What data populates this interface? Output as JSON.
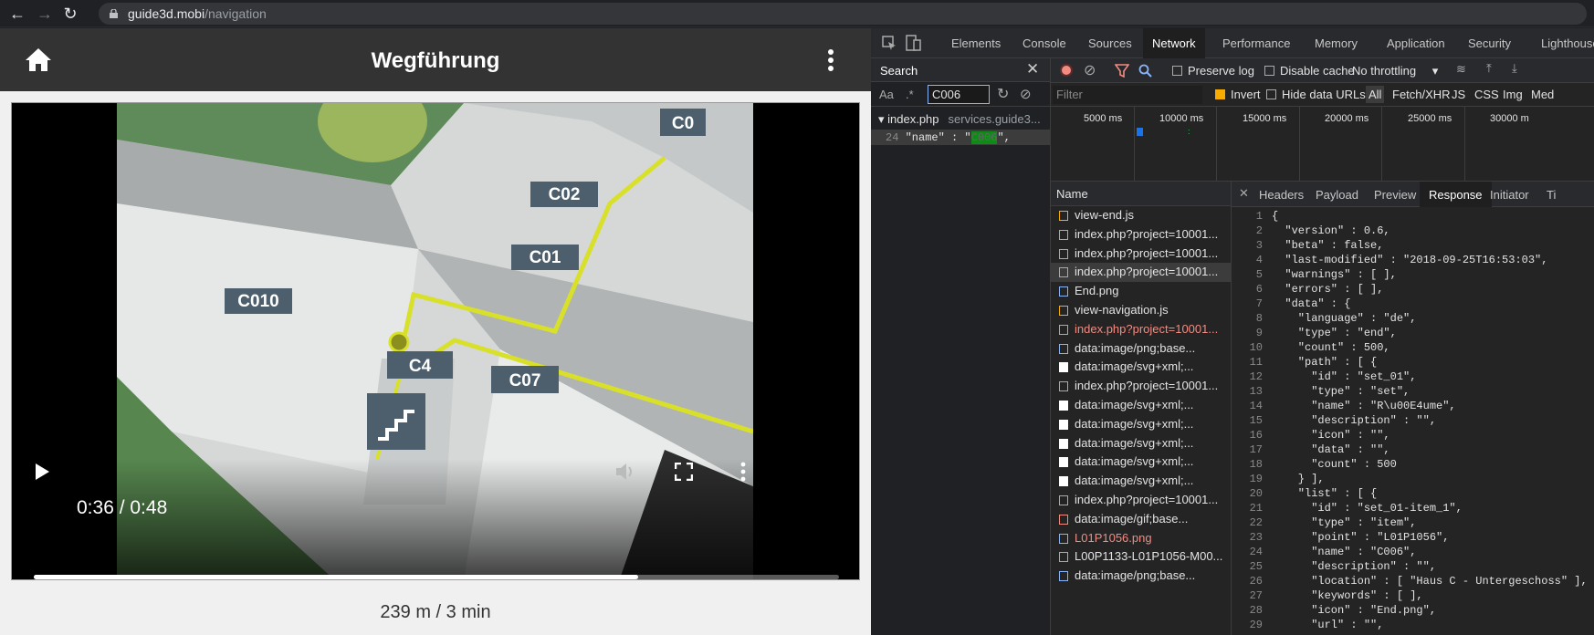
{
  "browser": {
    "url_host": "guide3d.mobi",
    "url_path": "/navigation"
  },
  "app": {
    "title": "Wegführung",
    "video": {
      "time_display": "0:36 / 0:48",
      "progress": 0.75,
      "map_labels": [
        "C02",
        "C01",
        "C010",
        "C4",
        "C07",
        "C0"
      ]
    },
    "distance": "239 m / 3 min"
  },
  "devtools": {
    "tabs": [
      "Elements",
      "Console",
      "Sources",
      "Network",
      "Performance",
      "Memory",
      "Application",
      "Security",
      "Lighthouse"
    ],
    "active_tab": "Network",
    "search": {
      "title": "Search",
      "case_label": "Aa",
      "regex_label": ".*",
      "query": "C006",
      "result_file": "index.php",
      "result_host": "services.guide3...",
      "result_line_no": "24",
      "result_line_prefix": "\"name\" : \"",
      "result_match": "C006",
      "result_line_suffix": "\","
    },
    "toolbar": {
      "preserve_log": "Preserve log",
      "disable_cache": "Disable cache",
      "throttling": "No throttling"
    },
    "filterbar": {
      "placeholder": "Filter",
      "invert": "Invert",
      "hide_data_urls": "Hide data URLs",
      "types": [
        "All",
        "Fetch/XHR",
        "JS",
        "CSS",
        "Img",
        "Med"
      ]
    },
    "timeline_ticks": [
      "5000 ms",
      "10000 ms",
      "15000 ms",
      "20000 ms",
      "25000 ms",
      "30000 m"
    ],
    "requests_header": "Name",
    "requests": [
      {
        "name": "view-end.js",
        "kind": "js"
      },
      {
        "name": "index.php?project=10001...",
        "kind": "doc"
      },
      {
        "name": "index.php?project=10001...",
        "kind": "doc"
      },
      {
        "name": "index.php?project=10001...",
        "kind": "doc",
        "selected": true
      },
      {
        "name": "End.png",
        "kind": "img"
      },
      {
        "name": "view-navigation.js",
        "kind": "js"
      },
      {
        "name": "index.php?project=10001...",
        "kind": "doc",
        "error": true
      },
      {
        "name": "data:image/png;base...",
        "kind": "img"
      },
      {
        "name": "data:image/svg+xml;...",
        "kind": "svg"
      },
      {
        "name": "index.php?project=10001...",
        "kind": "doc"
      },
      {
        "name": "data:image/svg+xml;...",
        "kind": "svg"
      },
      {
        "name": "data:image/svg+xml;...",
        "kind": "svg"
      },
      {
        "name": "data:image/svg+xml;...",
        "kind": "svg"
      },
      {
        "name": "data:image/svg+xml;...",
        "kind": "svg"
      },
      {
        "name": "data:image/svg+xml;...",
        "kind": "svg"
      },
      {
        "name": "index.php?project=10001...",
        "kind": "doc"
      },
      {
        "name": "data:image/gif;base...",
        "kind": "gif"
      },
      {
        "name": "L01P1056.png",
        "kind": "img",
        "error": true
      },
      {
        "name": "L00P1133-L01P1056-M00...",
        "kind": "doc"
      },
      {
        "name": "data:image/png;base...",
        "kind": "img"
      }
    ],
    "response_tabs": [
      "Headers",
      "Payload",
      "Preview",
      "Response",
      "Initiator",
      "Ti"
    ],
    "active_response_tab": "Response",
    "response_lines": [
      "{",
      "  \"version\" : 0.6,",
      "  \"beta\" : false,",
      "  \"last-modified\" : \"2018-09-25T16:53:03\",",
      "  \"warnings\" : [ ],",
      "  \"errors\" : [ ],",
      "  \"data\" : {",
      "    \"language\" : \"de\",",
      "    \"type\" : \"end\",",
      "    \"count\" : 500,",
      "    \"path\" : [ {",
      "      \"id\" : \"set_01\",",
      "      \"type\" : \"set\",",
      "      \"name\" : \"R\\u00E4ume\",",
      "      \"description\" : \"\",",
      "      \"icon\" : \"\",",
      "      \"data\" : \"\",",
      "      \"count\" : 500",
      "    } ],",
      "    \"list\" : [ {",
      "      \"id\" : \"set_01-item_1\",",
      "      \"type\" : \"item\",",
      "      \"point\" : \"L01P1056\",",
      "      \"name\" : \"C006\",",
      "      \"description\" : \"\",",
      "      \"location\" : [ \"Haus C - Untergeschoss\" ],",
      "      \"keywords\" : [ ],",
      "      \"icon\" : \"End.png\",",
      "      \"url\" : \"\","
    ]
  }
}
